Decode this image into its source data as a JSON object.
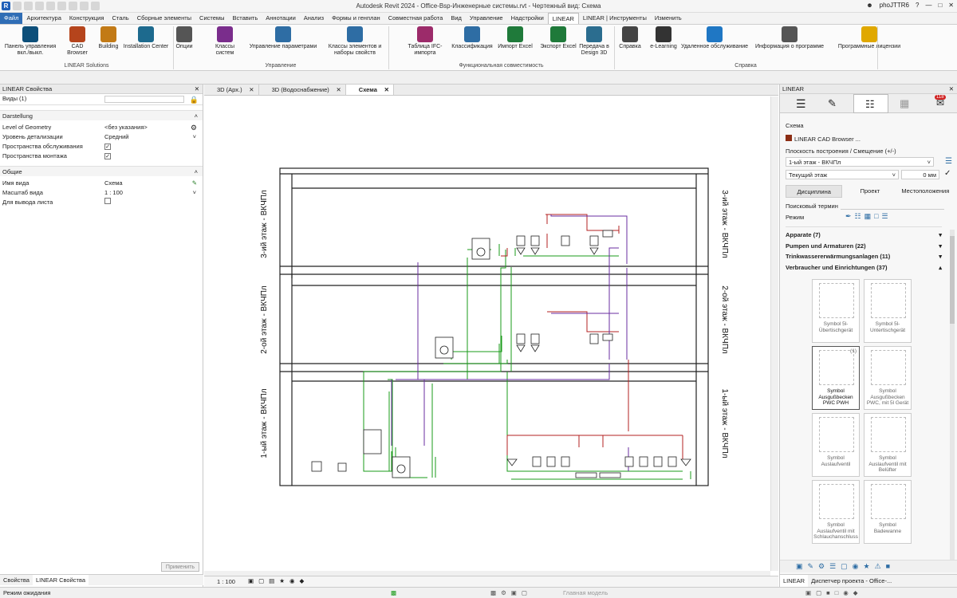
{
  "window": {
    "title": "Autodesk Revit 2024 - Office-Bsp-Инженерные системы.rvt - Чертежный вид: Схема",
    "user": "phoJTTR6"
  },
  "tabs": [
    "Файл",
    "Архитектура",
    "Конструкция",
    "Сталь",
    "Сборные элементы",
    "Системы",
    "Вставить",
    "Аннотации",
    "Анализ",
    "Формы и генплан",
    "Совместная работа",
    "Вид",
    "Управление",
    "Надстройки",
    "LINEAR",
    "LINEAR | Инструменты",
    "Изменить"
  ],
  "ribbon": {
    "buttons": [
      {
        "label": "Панель управления вкл./выкл.",
        "icon": "linear-control-panel-icon",
        "color": "#0d4f7a"
      },
      {
        "label": "CAD Browser",
        "icon": "cad-browser-icon",
        "color": "#b5441c"
      },
      {
        "label": "Building",
        "icon": "building-icon",
        "color": "#c27a16"
      },
      {
        "label": "Installation Center",
        "icon": "installation-center-icon",
        "color": "#1d6a8e"
      },
      {
        "label": "Опции",
        "icon": "gears-icon",
        "color": "#555"
      },
      {
        "label": "Классы систем",
        "icon": "system-classes-icon",
        "color": "#7a2d8c"
      },
      {
        "label": "Управление параметрами",
        "icon": "parameter-management-icon",
        "color": "#2e6da4"
      },
      {
        "label": "Классы элементов и наборы свойств",
        "icon": "element-classes-icon",
        "color": "#2e6da4"
      },
      {
        "label": "Таблица IFC-импорта",
        "icon": "ifc-table-icon",
        "color": "#9c2b6a"
      },
      {
        "label": "Классификация",
        "icon": "classification-icon",
        "color": "#2e6da4"
      },
      {
        "label": "Импорт Excel",
        "icon": "excel-import-icon",
        "color": "#1f7a3a"
      },
      {
        "label": "Экспорт Excel",
        "icon": "excel-export-icon",
        "color": "#1f7a3a"
      },
      {
        "label": "Передача в Design 3D",
        "icon": "design3d-transfer-icon",
        "color": "#2b6d8f"
      },
      {
        "label": "Справка",
        "icon": "help-book-icon",
        "color": "#444"
      },
      {
        "label": "e-Learning",
        "icon": "graduation-cap-icon",
        "color": "#333"
      },
      {
        "label": "Удаленное обслуживание",
        "icon": "remote-service-icon",
        "color": "#1f77c4"
      },
      {
        "label": "Информация о программе",
        "icon": "info-icon",
        "color": "#555"
      },
      {
        "label": "Программные лицензии",
        "icon": "key-icon",
        "color": "#e0a800"
      }
    ],
    "groups": [
      "LINEAR Solutions",
      "Управление",
      "Функциональная совместимость",
      "Справка"
    ]
  },
  "properties": {
    "header": "LINEAR Свойства",
    "type_selector": "Виды (1)",
    "section1": "Darstellung",
    "level_of_geometry_label": "Level of Geometry",
    "level_of_geometry_value": "<без указания>",
    "detail_level_label": "Уровень детализации",
    "detail_level_value": "Средний",
    "service_space_label": "Пространства обслуживания",
    "install_space_label": "Пространства монтажа",
    "section2": "Общие",
    "view_name_label": "Имя вида",
    "view_name_value": "Схема",
    "scale_label": "Масштаб вида",
    "scale_value": "1 : 100",
    "for_sheet_label": "Для вывода листа",
    "apply_button": "Применить",
    "bottom_tab1": "Свойства",
    "bottom_tab2": "LINEAR Свойства"
  },
  "view_tabs": [
    "3D (Арх.)",
    "3D (Водоснабжение)",
    "Схема"
  ],
  "drawing": {
    "floors": [
      "3-ий этаж - ВКЧПл",
      "2-ой этаж - ВКЧПл",
      "1-ый этаж - ВКЧПл"
    ]
  },
  "view_bar": {
    "scale": "1 : 100"
  },
  "linear_panel": {
    "header": "LINEAR",
    "badge": "118",
    "schema_label": "Схема",
    "browser_label": "LINEAR CAD Browser ...",
    "plane_label": "Плоскость построения / Смещение (+/-)",
    "plane_value": "1-ый этаж - ВКЧПл",
    "level_value": "Текущий этаж",
    "offset_value": "0 мм",
    "filter_tabs": [
      "Дисциплина",
      "Проект",
      "Местоположения"
    ],
    "search_label": "Поисковый термин",
    "mode_label": "Режим",
    "categories": [
      {
        "name": "Apparate (7)",
        "state": "▾"
      },
      {
        "name": "Pumpen und Armaturen (22)",
        "state": "▾"
      },
      {
        "name": "Trinkwassererwärmungsanlagen (11)",
        "state": "▾"
      },
      {
        "name": "Verbraucher und Einrichtungen (37)",
        "state": "▴"
      }
    ],
    "tiles": [
      "Symbol 5l-Übertischgerät",
      "Symbol 5l-Untertischgerät",
      "Symbol Ausgußbecken PWC PWH",
      "Symbol Ausgußbecken PWC, mit 5l Gerät",
      "Symbol Auslaufventil",
      "Symbol Auslaufventil mit Belüfter",
      "Symbol Auslaufventil mit Schlauchanschluss",
      "Symbol Badewanne"
    ],
    "selected_count": "(1)",
    "bottom_tab1": "LINEAR",
    "bottom_tab2": "Диспетчер проекта - Office-..."
  },
  "status": {
    "text": "Режим ожидания",
    "model": "Главная модель"
  }
}
